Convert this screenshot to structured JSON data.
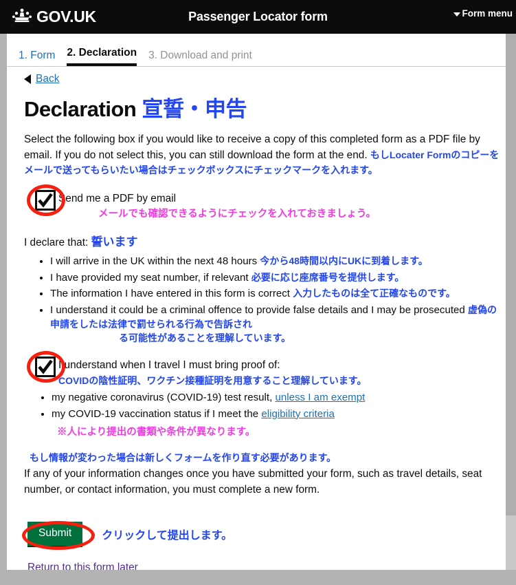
{
  "header": {
    "brand": "GOV.UK",
    "crown_icon": "crown-icon",
    "title": "Passenger Locator form",
    "menu_label": "Form menu",
    "menu_icon": "chevron-down-icon"
  },
  "tabs": [
    {
      "label": "1. Form",
      "state": "done"
    },
    {
      "label": "2. Declaration",
      "state": "active"
    },
    {
      "label": "3. Download and print",
      "state": "todo"
    }
  ],
  "back": {
    "label": "Back",
    "icon": "back-arrow-icon"
  },
  "page": {
    "title_en": "Declaration ",
    "title_jp": "宣誓・申告",
    "intro_en": "Select the following box if you would like to receive a copy of this completed form as a PDF file by email. If you do not select this, you can still download the form at the end. ",
    "intro_jp": "もしLocater Formのコピーをメールで送ってもらいたい場合はチェックボックスにチェックマークを入れます。"
  },
  "checkbox_pdf": {
    "checked": true,
    "label": "Send me a PDF by email",
    "note_jp": "メールでも確認できるようにチェックを入れておきましょう。"
  },
  "declare": {
    "label_en": "I declare that: ",
    "label_jp": "誓います",
    "items": [
      {
        "en": "I will arrive in the UK within the next 48 hours ",
        "jp": "今から48時間以内にUKに到着します。"
      },
      {
        "en": "I have provided my seat number, if relevant ",
        "jp": "必要に応じ座席番号を提供します。"
      },
      {
        "en": "The information I have entered in this form is correct  ",
        "jp": "入力したものは全て正確なものです。"
      },
      {
        "en": "I understand it could be a criminal offence to provide false details and I may be prosecuted ",
        "jp": "虚偽の申請をしたは法律で罰せられる行為で告訴され",
        "jp2": "る可能性があることを理解しています。"
      }
    ]
  },
  "checkbox_proof": {
    "checked": true,
    "label": "I understand when I travel I must bring proof of:",
    "note_jp": "COVIDの陰性証明、ワクチン接種証明を用意すること理解しています。",
    "items": [
      {
        "text": "my negative coronavirus (COVID-19) test result, ",
        "link": "unless I am exempt"
      },
      {
        "text": "my COVID-19 vaccination status if I meet the ",
        "link": "eligibility criteria"
      }
    ],
    "sub_note_jp": "※人により提出の書類や条件が異なります。"
  },
  "changes": {
    "note_jp": "もし情報が変わった場合は新しくフォームを作り直す必要があります。",
    "text_en": "If any of your information changes once you have submitted your form, such as travel details, seat number, or contact information, you must complete a new form."
  },
  "submit": {
    "label": "Submit",
    "note_jp": "クリックして提出します。"
  },
  "return_link": "Return to this form later",
  "colors": {
    "header_bg": "#0b0c0c",
    "progress_blue": "#0b63a3",
    "link_blue": "#1d70b8",
    "annotation_blue": "#2346f0",
    "annotation_pink": "#f03ce0",
    "highlight_red": "#f52010",
    "submit_green": "#00703c",
    "visited_link": "#4c2c92"
  }
}
